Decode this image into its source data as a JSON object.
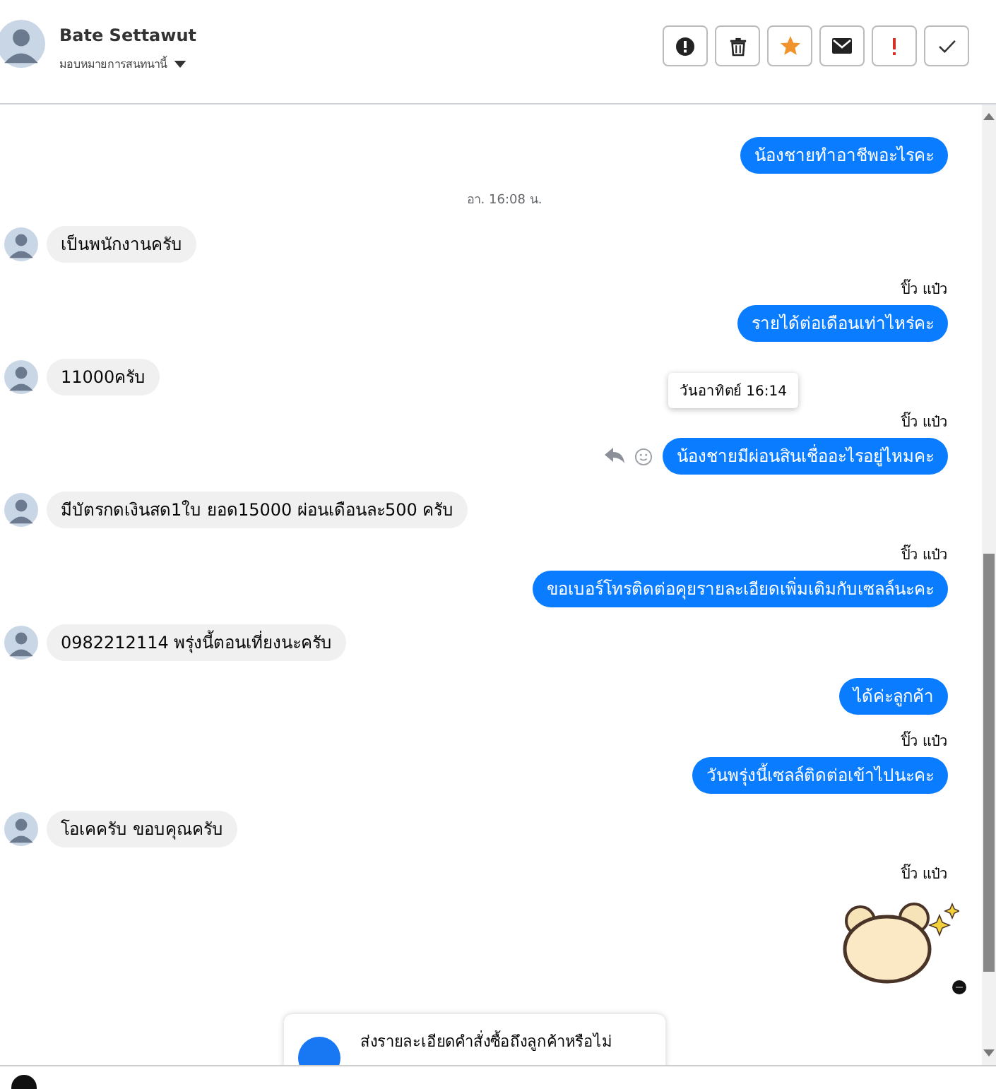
{
  "header": {
    "name": "Bate Settawut",
    "assign_label": "มอบหมายการสนทนานี้",
    "actions": [
      {
        "kind": "alert"
      },
      {
        "kind": "trash"
      },
      {
        "kind": "star"
      },
      {
        "kind": "mail"
      },
      {
        "kind": "important"
      },
      {
        "kind": "done"
      }
    ]
  },
  "messages": [
    {
      "kind": "outgoing",
      "text": "น้องชายทำอาชีพอะไรคะ"
    },
    {
      "kind": "timestamp",
      "text": "อา. 16:08 น."
    },
    {
      "kind": "incoming",
      "text": "เป็นพนักงานครับ"
    },
    {
      "kind": "sender",
      "text": "ปิ๊ว แป๋ว"
    },
    {
      "kind": "outgoing",
      "text": "รายได้ต่อเดือนเท่าไหร่คะ"
    },
    {
      "kind": "incoming",
      "text": "11000ครับ"
    },
    {
      "kind": "sender",
      "text": "ปิ๊ว แป๋ว"
    },
    {
      "kind": "outgoing",
      "text": "น้องชายมีผ่อนสินเชื่ออะไรอยู่ไหมคะ",
      "tooltip": "วันอาทิตย์ 16:14",
      "hovered": true
    },
    {
      "kind": "incoming",
      "text": "มีบัตรกดเงินสด1ใบ ยอด15000 ผ่อนเดือนละ500 ครับ"
    },
    {
      "kind": "sender",
      "text": "ปิ๊ว แป๋ว"
    },
    {
      "kind": "outgoing",
      "text": "ขอเบอร์โทรติดต่อคุยรายละเอียดเพิ่มเติมกับเซลล์นะคะ"
    },
    {
      "kind": "incoming",
      "text": "0982212114 พรุ่งนี้ตอนเที่ยงนะครับ"
    },
    {
      "kind": "outgoing",
      "text": "ได้ค่ะลูกค้า"
    },
    {
      "kind": "sender",
      "text": "ปิ๊ว แป๋ว"
    },
    {
      "kind": "outgoing",
      "text": "วันพรุ่งนี้เซลล์ติดต่อเข้าไปนะคะ"
    },
    {
      "kind": "incoming",
      "text": "โอเคครับ ขอบคุณครับ"
    },
    {
      "kind": "sender",
      "text": "ปิ๊ว แป๋ว"
    },
    {
      "kind": "sticker"
    }
  ],
  "prompt_card": {
    "text": "ส่งรายละเอียดคำสั่งซื้อถึงลูกค้าหรือไม่"
  }
}
